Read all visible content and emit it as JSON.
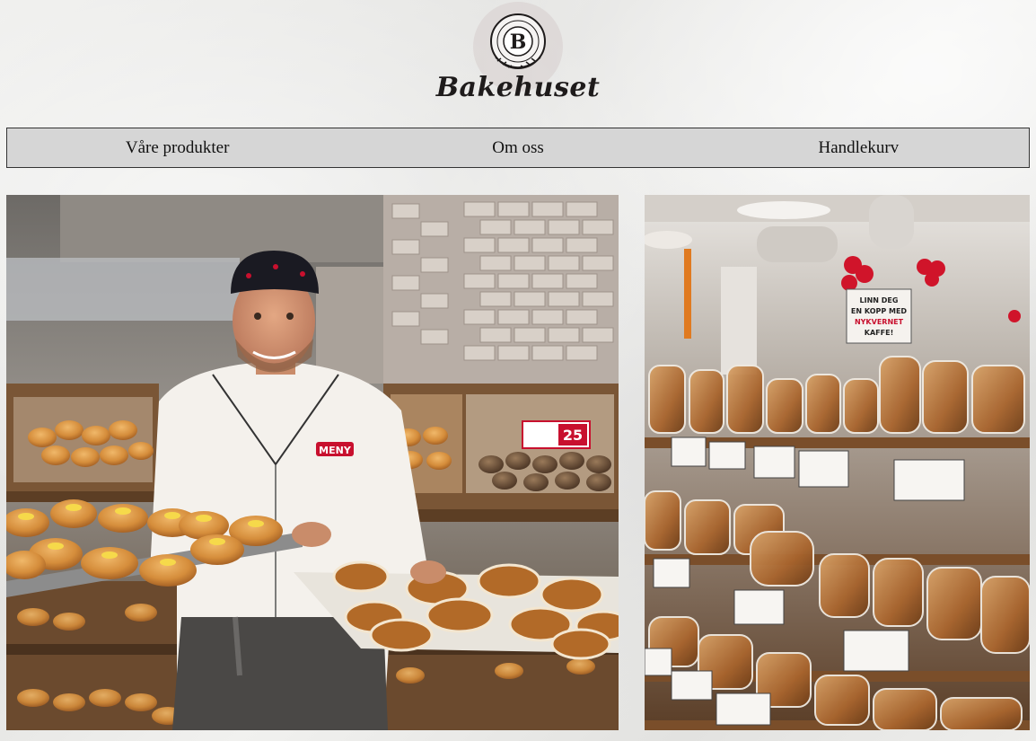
{
  "brand": {
    "emblem_top_text": "BAKEHUSET",
    "emblem_bottom_text": "GODE TRADISJONER",
    "emblem_letter": "B",
    "name": "Bakehuset"
  },
  "nav": {
    "items": [
      {
        "label": "Våre produkter"
      },
      {
        "label": "Om oss"
      },
      {
        "label": "Handlekurv"
      }
    ]
  },
  "photos": {
    "left": {
      "apron_logo_text": "MENY",
      "price_tag_text": "25"
    },
    "right": {
      "sign_text_line1": "LINN DEG",
      "sign_text_line2": "EN KOPP MED",
      "sign_text_line3": "NYKVERNET",
      "sign_text_line4": "KAFFE!"
    }
  },
  "colors": {
    "nav_background": "#d6d6d6",
    "nav_border": "#333333",
    "text": "#111111",
    "apron_logo": "#c8102e"
  }
}
